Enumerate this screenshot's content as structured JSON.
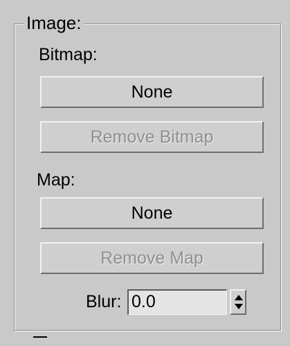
{
  "group": {
    "title": "Image:"
  },
  "bitmap": {
    "label": "Bitmap:",
    "button": "None",
    "remove": "Remove Bitmap"
  },
  "map": {
    "label": "Map:",
    "button": "None",
    "remove": "Remove Map"
  },
  "blur": {
    "label": "Blur:",
    "value": "0.0"
  }
}
